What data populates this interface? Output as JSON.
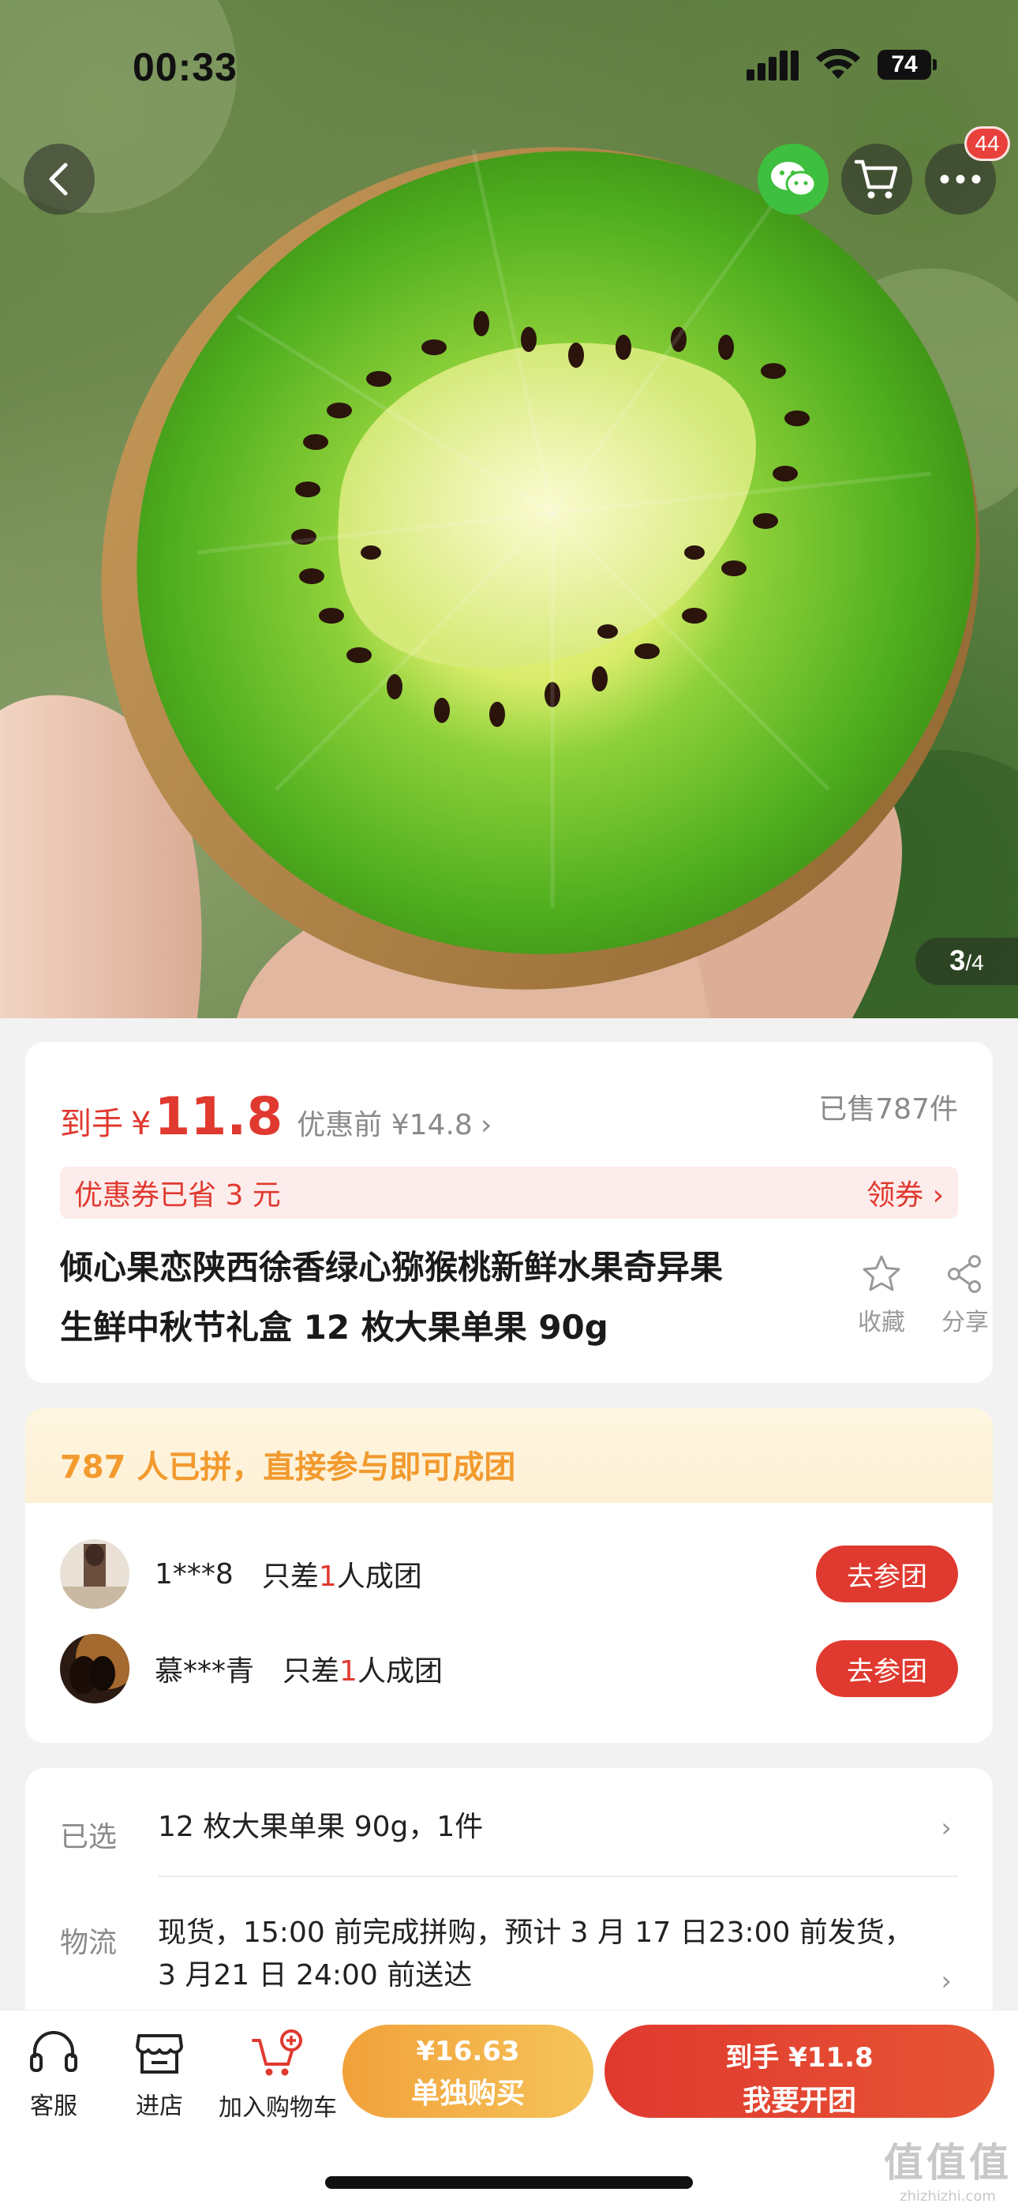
{
  "status_bar": {
    "time": "00:33",
    "battery": "74"
  },
  "header": {
    "badge_count": "44"
  },
  "image_counter": {
    "current": "3",
    "separator": "/",
    "total": "4"
  },
  "price": {
    "label": "到手",
    "currency": "¥",
    "value": "11.8",
    "before_label": "优惠前 ¥14.8",
    "before_arrow": "›",
    "sold": "已售787件"
  },
  "coupon": {
    "text": "优惠券已省 3 元",
    "claim": "领券 ›"
  },
  "product": {
    "title_line1": "倾心果恋陕西徐香绿心猕猴桃新鲜水果奇异果",
    "title_line2": "生鲜中秋节礼盒 12 枚大果单果 90g",
    "favorite_label": "收藏",
    "share_label": "分享"
  },
  "group_buy": {
    "header": "787 人已拼，直接参与即可成团",
    "rows": [
      {
        "user": "1***8",
        "need_prefix": "只差",
        "need_num": "1",
        "need_suffix": "人成团",
        "button": "去参团"
      },
      {
        "user": "慕***青",
        "need_prefix": "只差",
        "need_num": "1",
        "need_suffix": "人成团",
        "button": "去参团"
      }
    ]
  },
  "spec": {
    "selected_label": "已选",
    "selected_value": "12 枚大果单果 90g，1件",
    "logistics_label": "物流",
    "logistics_value": "现货，15:00 前完成拼购，预计 3 月 17 日23:00 前发货，3 月21 日 24:00 前送达",
    "arrow": "›"
  },
  "bottom_bar": {
    "service": "客服",
    "store": "进店",
    "add_cart": "加入购物车",
    "single_price": "¥16.63",
    "single_label": "单独购买",
    "group_price": "到手 ¥11.8",
    "group_label": "我要开团"
  },
  "watermark": {
    "main": "值值值",
    "sub": "zhizhizhi.com"
  },
  "colors": {
    "accent_red": "#e0392f",
    "accent_orange": "#f29a2e",
    "wechat_green": "#3fbf3f"
  }
}
